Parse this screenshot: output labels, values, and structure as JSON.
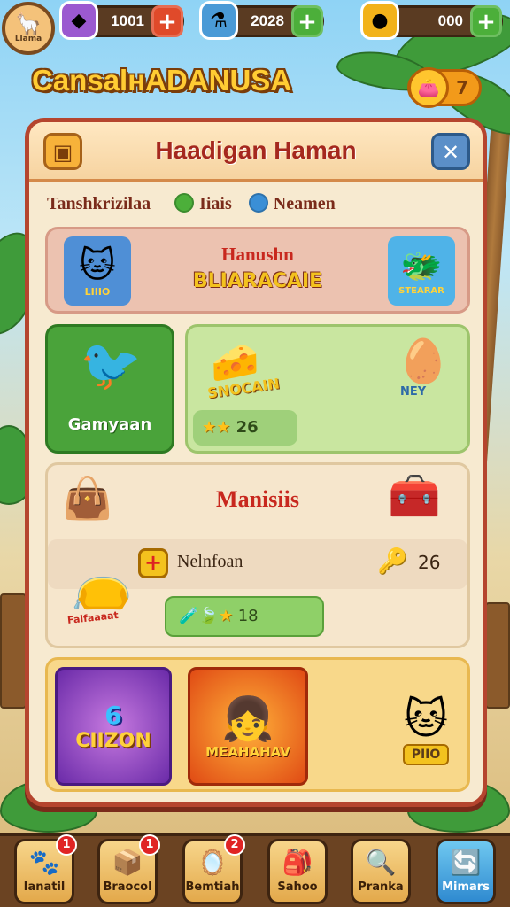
{
  "resources": [
    {
      "name": "gems",
      "icon": "gem-icon",
      "value": "1001",
      "plus": "+",
      "plus_color": "#e04a2a"
    },
    {
      "name": "potions",
      "icon": "potion-icon",
      "value": "2028",
      "plus": "+",
      "plus_color": "#4caf3a"
    },
    {
      "name": "coins",
      "icon": "coin-icon",
      "value": "000",
      "plus": "+",
      "plus_color": "#4caf3a"
    }
  ],
  "avatar": {
    "label": "Llama"
  },
  "game_title": "CansalнADANUSA",
  "coin_badge": {
    "value": "7"
  },
  "panel": {
    "title": "Haadigan Haman",
    "subtitle": "Tanshkrizilaa",
    "legend": [
      {
        "label": "Iiais",
        "color": "#4caf3a"
      },
      {
        "label": "Neamen",
        "color": "#3a8fd6"
      }
    ],
    "banner": {
      "line1": "Hanushn",
      "line2": "BLIARACAIE",
      "left_tag": "LIIIO",
      "right_tag": "STEARAR"
    },
    "green_card": {
      "label": "Gamyaan"
    },
    "reward_card": {
      "item_label": "SNOCAIN",
      "egg_label": "NEY",
      "stars": "26"
    },
    "mission": {
      "title": "Manisiis",
      "task_label": "Nelnfoan",
      "task_count": "26",
      "bag_label": "Falfaaaat",
      "reward": "18"
    },
    "promo": [
      {
        "label": "CIIZON",
        "badge": "6"
      },
      {
        "label": "MEAHAHAV"
      },
      {
        "label": "PIIO"
      }
    ]
  },
  "nav": [
    {
      "label": "Ianatil",
      "icon": "pet-icon",
      "badge": "1"
    },
    {
      "label": "Braocol",
      "icon": "box-icon",
      "badge": "1"
    },
    {
      "label": "Bemtiah",
      "icon": "mirror-icon",
      "badge": "2"
    },
    {
      "label": "Sahoo",
      "icon": "bag-icon",
      "badge": ""
    },
    {
      "label": "Pranka",
      "icon": "magnifier-icon",
      "badge": ""
    },
    {
      "label": "Mimars",
      "icon": "refresh-icon",
      "badge": ""
    }
  ],
  "colors": {
    "panel_border": "#b5452e",
    "title_red": "#a5281e",
    "green": "#4caf3a",
    "gold": "#ffc21a"
  }
}
